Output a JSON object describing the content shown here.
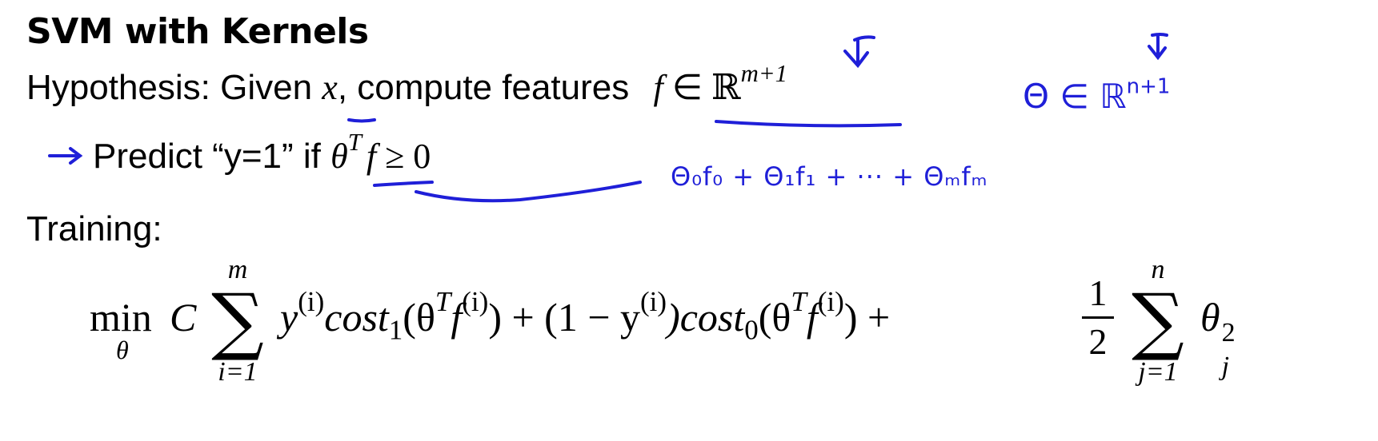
{
  "title": "SVM with Kernels",
  "hypothesis": {
    "label": "Hypothesis: Given ",
    "x_var": "x",
    "mid": ", compute features ",
    "f_var": "f",
    "in": " ∈ ",
    "reals": "ℝ",
    "exponent": "m+1"
  },
  "predict": {
    "text": "Predict “y=1” if ",
    "theta": "θ",
    "T": "T",
    "f": "f",
    "rel": " ≥ 0"
  },
  "training_label": "Training:",
  "formula": {
    "min": "min",
    "min_sub": "θ",
    "C": "C",
    "sum1_top": "m",
    "sum1_bottom": "i=1",
    "part1": "y",
    "sup_i": "(i)",
    "cost1": "cost",
    "cost1_sub": "1",
    "paren1": "(θ",
    "T": "T",
    "f_i": "f",
    "close_plus": ") + (1 − y",
    "cost0_open": ")cost",
    "cost0_sub": "0",
    "close_plus2": ") + ",
    "frac_num": "1",
    "frac_den": "2",
    "sum2_top": "n",
    "sum2_bottom": "j=1",
    "theta_j": "θ",
    "theta_sup": "2",
    "theta_sub": "j"
  },
  "annotations": {
    "theta_in": "Θ ∈ ℝ",
    "theta_exp": "n+1",
    "expansion": "Θ₀f₀ + Θ₁f₁ + ··· + Θₘfₘ",
    "ink_color": "#1f1fd8"
  }
}
